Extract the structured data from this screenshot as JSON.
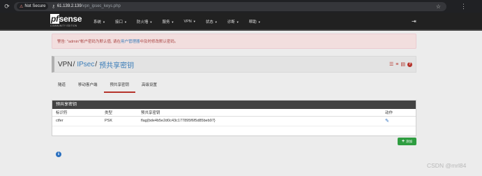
{
  "browser": {
    "security_label": "Not Secure",
    "url_host": "61.139.2.139",
    "url_path": "/vpn_ipsec_keys.php"
  },
  "brand": {
    "logo_text_pf": "pf",
    "logo_text_sense": "sense",
    "edition": "COMMUNITY EDITION"
  },
  "menu": [
    {
      "label": "系统"
    },
    {
      "label": "接口"
    },
    {
      "label": "防火墙"
    },
    {
      "label": "服务"
    },
    {
      "label": "VPN"
    },
    {
      "label": "状态"
    },
    {
      "label": "诊断"
    },
    {
      "label": "帮助"
    }
  ],
  "alert": {
    "prefix": "警告: \"admin\"帐户密码为默认值, 请在",
    "link": "用户管理器",
    "suffix": "中及时修改默认密码。"
  },
  "breadcrumb": {
    "vpn": "VPN",
    "ipsec": "IPsec",
    "current": "预共享密钥"
  },
  "tabs": [
    {
      "label": "隧道",
      "active": false
    },
    {
      "label": "移动客户端",
      "active": false
    },
    {
      "label": "预共享密钥",
      "active": true
    },
    {
      "label": "高级设置",
      "active": false
    }
  ],
  "panel": {
    "title": "预共享密钥",
    "columns": [
      "标识符",
      "类型",
      "预共享密钥",
      "动作"
    ],
    "rows": [
      {
        "identifier": "ctfer",
        "type": "PSK",
        "key": "flag{bde4b5e2d0c43c177895f6f5d85beb97}"
      }
    ]
  },
  "add_button": {
    "label": "添加"
  },
  "watermark": "CSDN @mrl84",
  "colors": {
    "accent": "#b5332b",
    "add": "#2e9d40",
    "link": "#3a7cb8"
  }
}
